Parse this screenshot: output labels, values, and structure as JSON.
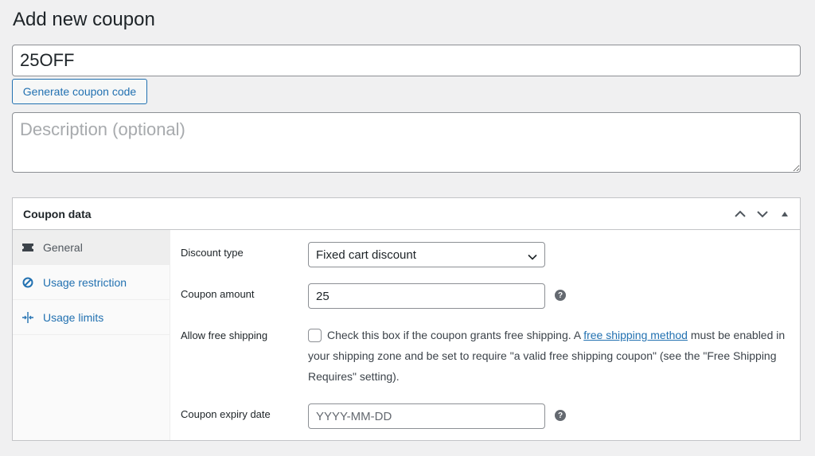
{
  "page": {
    "title": "Add new coupon"
  },
  "coupon": {
    "code_value": "25OFF",
    "generate_label": "Generate coupon code",
    "description_placeholder": "Description (optional)"
  },
  "panel": {
    "title": "Coupon data",
    "tabs": [
      {
        "label": "General",
        "icon": "ticket-icon",
        "active": true
      },
      {
        "label": "Usage restriction",
        "icon": "restriction-icon",
        "active": false
      },
      {
        "label": "Usage limits",
        "icon": "limits-icon",
        "active": false
      }
    ],
    "fields": {
      "discount_type": {
        "label": "Discount type",
        "value": "Fixed cart discount"
      },
      "coupon_amount": {
        "label": "Coupon amount",
        "value": "25"
      },
      "free_shipping": {
        "label": "Allow free shipping",
        "text_before": "Check this box if the coupon grants free shipping. A ",
        "link_text": "free shipping method",
        "text_after": " must be enabled in your shipping zone and be set to require \"a valid free shipping coupon\" (see the \"Free Shipping Requires\" setting).",
        "checked": false
      },
      "expiry_date": {
        "label": "Coupon expiry date",
        "placeholder": "YYYY-MM-DD"
      }
    },
    "help_glyph": "?"
  },
  "colors": {
    "accent": "#2271b1",
    "background": "#f0f0f1"
  }
}
